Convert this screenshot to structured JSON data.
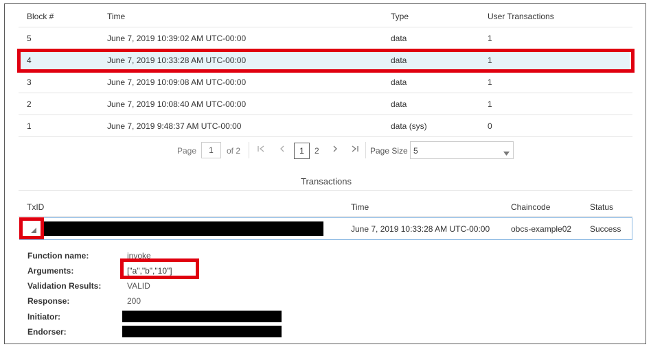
{
  "blocks_table": {
    "headers": {
      "block": "Block #",
      "time": "Time",
      "type": "Type",
      "user_tx": "User Transactions"
    },
    "rows": [
      {
        "block": "5",
        "time": "June 7, 2019 10:39:02 AM UTC-00:00",
        "type": "data",
        "user_tx": "1"
      },
      {
        "block": "4",
        "time": "June 7, 2019 10:33:28 AM UTC-00:00",
        "type": "data",
        "user_tx": "1"
      },
      {
        "block": "3",
        "time": "June 7, 2019 10:09:08 AM UTC-00:00",
        "type": "data",
        "user_tx": "1"
      },
      {
        "block": "2",
        "time": "June 7, 2019 10:08:40 AM UTC-00:00",
        "type": "data",
        "user_tx": "1"
      },
      {
        "block": "1",
        "time": "June 7, 2019 9:48:37 AM UTC-00:00",
        "type": "data (sys)",
        "user_tx": "0"
      }
    ],
    "selected_block": "4"
  },
  "pagination": {
    "page_label": "Page",
    "page_value": "1",
    "of_label": "of 2",
    "pages": [
      "1",
      "2"
    ],
    "current_page": "1",
    "page_size_label": "Page Size",
    "page_size_value": "5",
    "icons": {
      "first": "first-page-icon",
      "prev": "prev-page-icon",
      "next": "next-page-icon",
      "last": "last-page-icon"
    }
  },
  "transactions": {
    "title": "Transactions",
    "headers": {
      "txid": "TxID",
      "time": "Time",
      "chaincode": "Chaincode",
      "status": "Status"
    },
    "row": {
      "time": "June 7, 2019 10:33:28 AM UTC-00:00",
      "chaincode": "obcs-example02",
      "status": "Success"
    },
    "details": [
      {
        "label": "Function name:",
        "value": "invoke"
      },
      {
        "label": "Arguments:",
        "value": "[\"a\",\"b\",\"10\"]"
      },
      {
        "label": "Validation Results:",
        "value": "VALID"
      },
      {
        "label": "Response:",
        "value": "200"
      },
      {
        "label": "Initiator:",
        "value": ""
      },
      {
        "label": "Endorser:",
        "value": ""
      }
    ]
  },
  "colors": {
    "highlight": "#e0000f",
    "selected_row": "#e7f3f8",
    "tx_row_border": "#8ab8e2"
  }
}
